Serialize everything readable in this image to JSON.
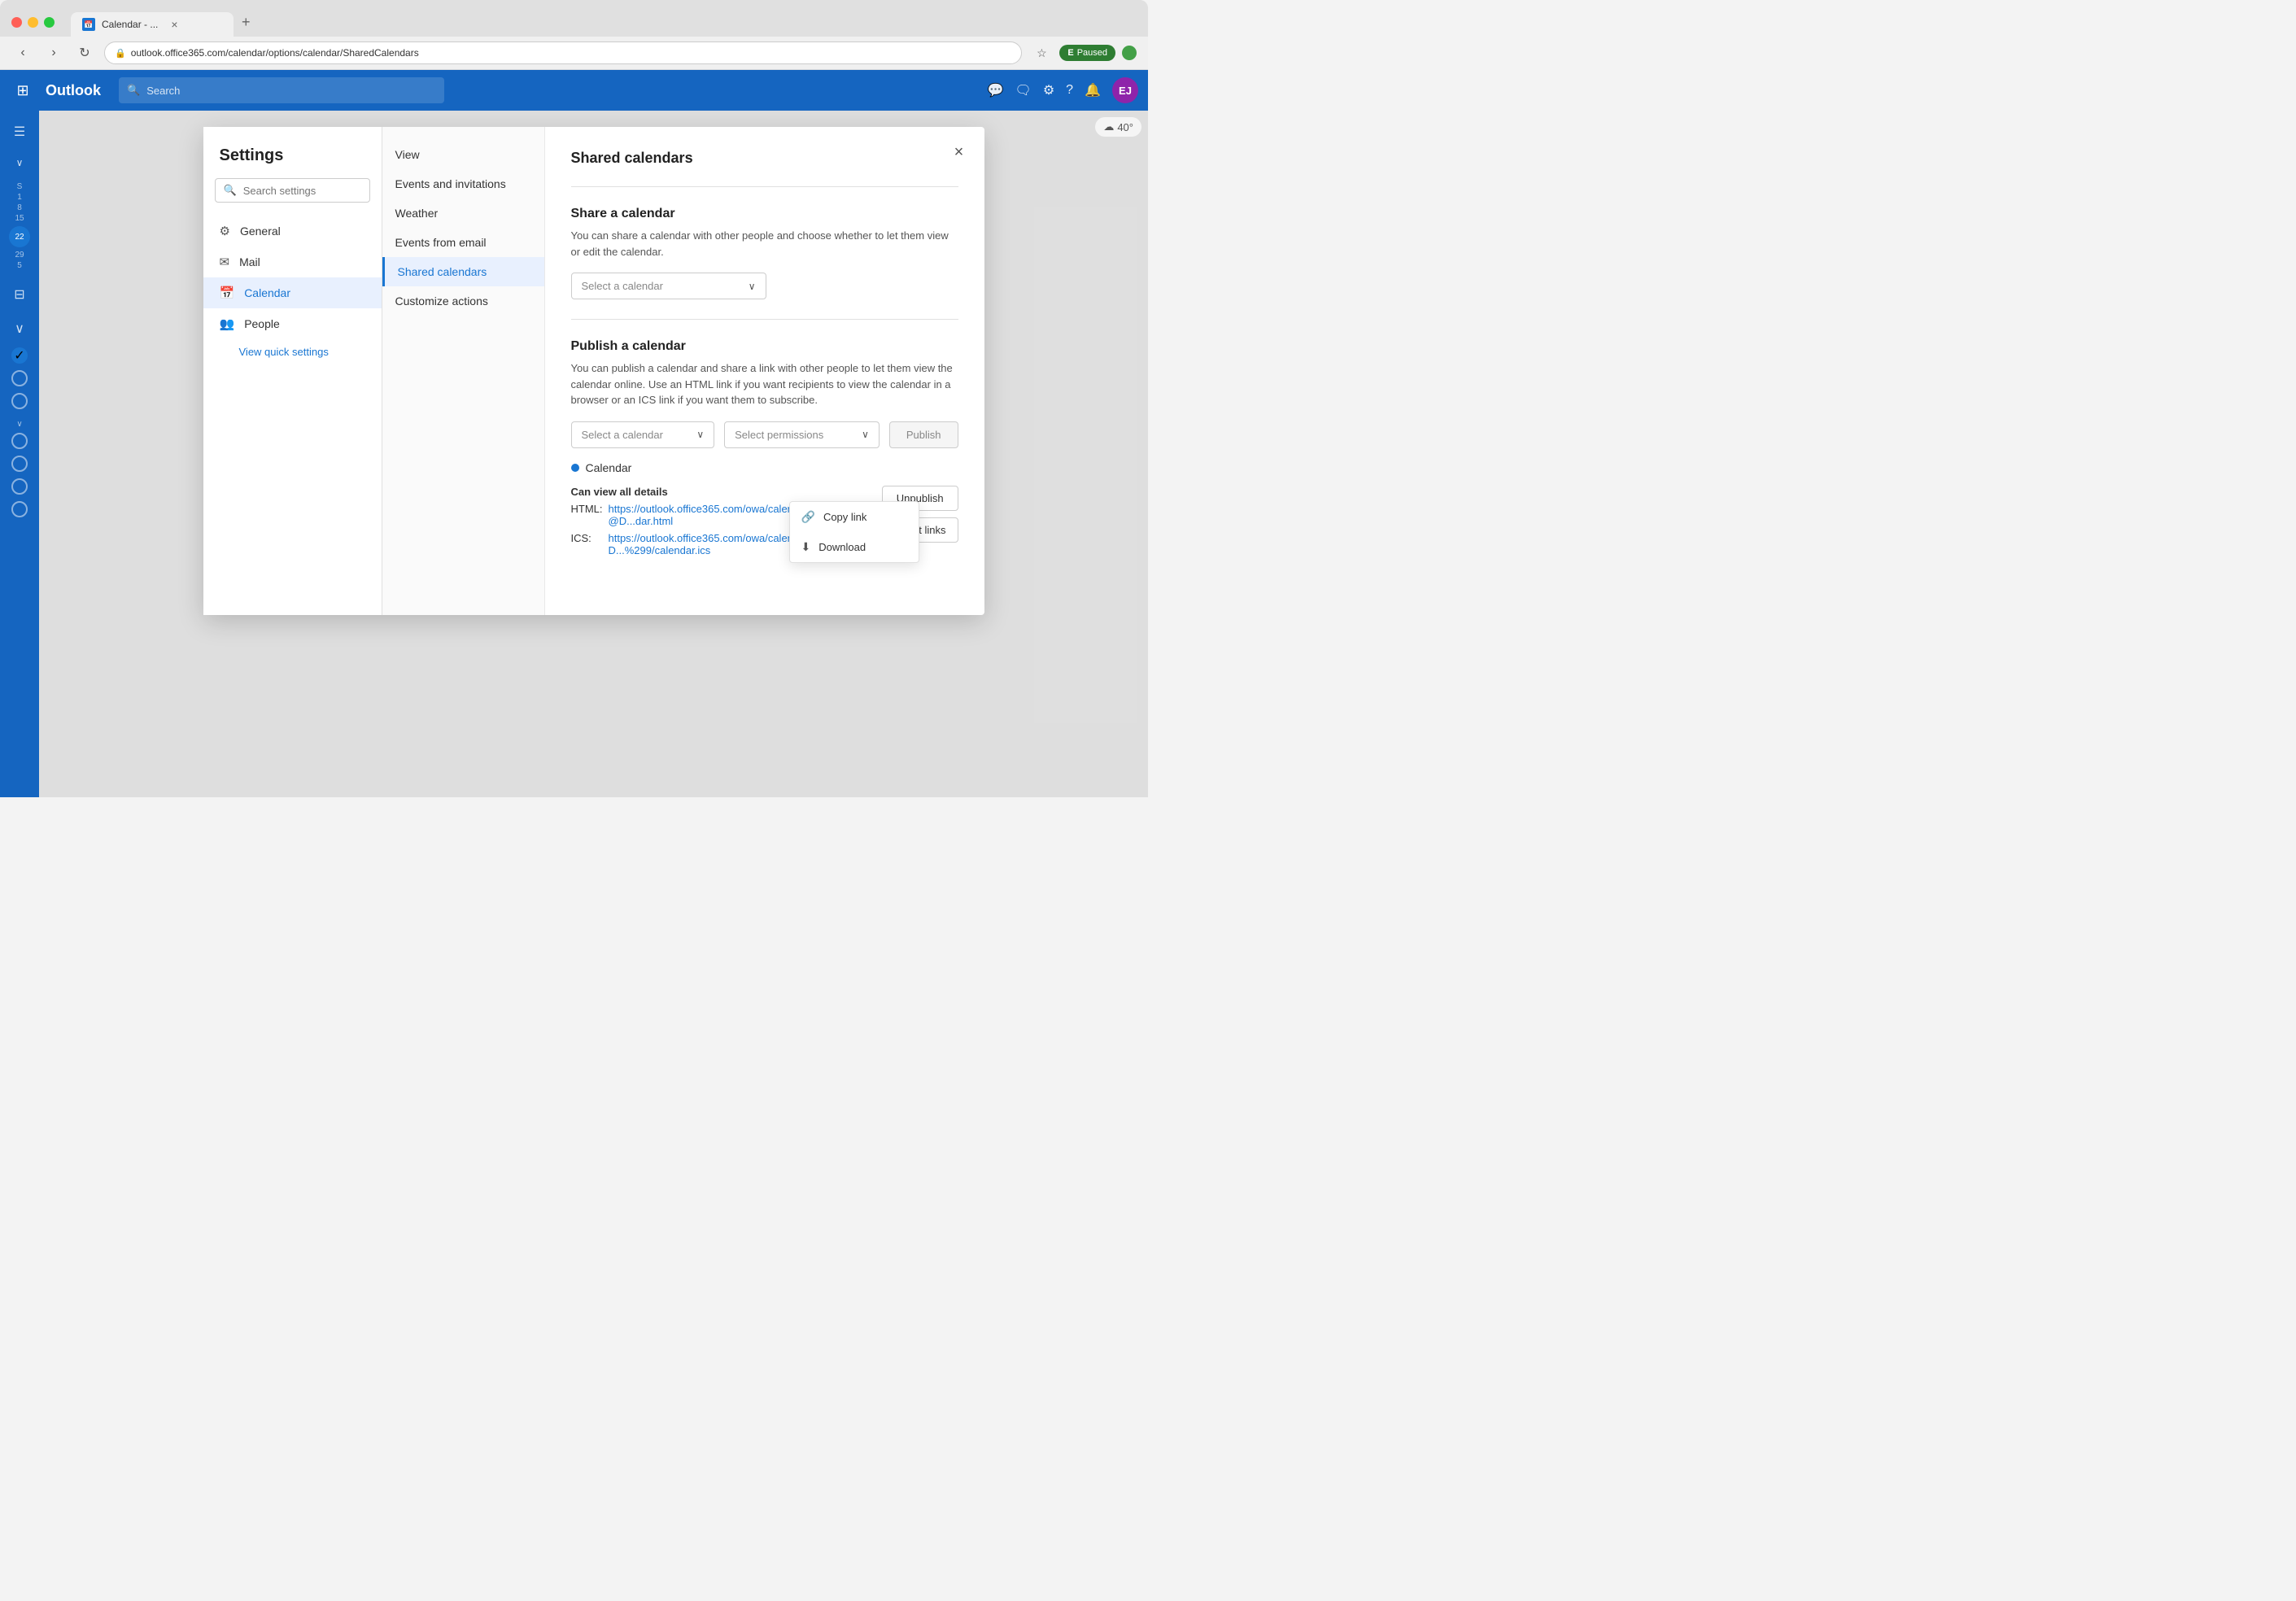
{
  "browser": {
    "tab_title": "Calendar - ...",
    "tab_close": "×",
    "tab_new": "+",
    "address": "outlook.office365.com/calendar/options/calendar/SharedCalendars",
    "nav_back": "‹",
    "nav_forward": "›",
    "nav_reload": "↻",
    "lock_icon": "🔒",
    "paused_label": "Paused"
  },
  "outlook": {
    "logo": "Outlook",
    "search_placeholder": "Search",
    "header_icons": {
      "chat": "💬",
      "teams": "🗨",
      "settings": "⚙",
      "help": "?",
      "notifications": "🔔",
      "avatar_initials": "EJ"
    }
  },
  "settings": {
    "title": "Settings",
    "search_placeholder": "Search settings",
    "nav_items": [
      {
        "icon": "⚙",
        "label": "General"
      },
      {
        "icon": "✉",
        "label": "Mail"
      },
      {
        "icon": "📅",
        "label": "Calendar",
        "active": true
      },
      {
        "icon": "👥",
        "label": "People"
      }
    ],
    "quick_settings_link": "View quick settings",
    "middle_nav": [
      {
        "label": "View"
      },
      {
        "label": "Events and invitations"
      },
      {
        "label": "Weather"
      },
      {
        "label": "Events from email"
      },
      {
        "label": "Shared calendars",
        "active": true
      },
      {
        "label": "Customize actions"
      }
    ],
    "content": {
      "title": "Shared calendars",
      "close_icon": "×",
      "share_section": {
        "title": "Share a calendar",
        "description": "You can share a calendar with other people and choose whether to let them view or edit the calendar.",
        "select_placeholder": "Select a calendar"
      },
      "publish_section": {
        "title": "Publish a calendar",
        "description": "You can publish a calendar and share a link with other people to let them view the calendar online. Use an HTML link if you want recipients to view the calendar in a browser or an ICS link if you want them to subscribe.",
        "select_placeholder": "Select a calendar",
        "permissions_placeholder": "Select permissions",
        "publish_button": "Publish",
        "calendar_name": "Calendar",
        "can_view_label": "Can view all details",
        "html_label": "HTML:",
        "html_url": "https://outlook.office365.com/owa/calendar/3c59...2d87b2f@D...dar.html",
        "ics_label": "ICS:",
        "ics_url": "https://outlook.office365.com/owa/calendar/2cf...1b2f@D...%299/calendar.ics",
        "unpublish_button": "Unpublish",
        "reset_links_button": "Reset links"
      }
    }
  },
  "context_menu": {
    "items": [
      {
        "icon": "🔗",
        "label": "Copy link"
      },
      {
        "icon": "⬇",
        "label": "Download"
      }
    ]
  },
  "weather": {
    "temp": "40°"
  }
}
